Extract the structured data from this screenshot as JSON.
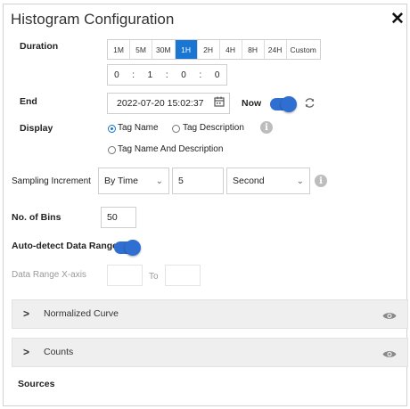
{
  "dialog": {
    "title": "Histogram Configuration",
    "close_label": "✕"
  },
  "duration": {
    "label": "Duration",
    "buttons": [
      "1M",
      "5M",
      "30M",
      "1H",
      "2H",
      "4H",
      "8H",
      "24H",
      "Custom"
    ],
    "active": "1H",
    "time_fields": [
      "0",
      ":",
      "1",
      ":",
      "0",
      ":",
      "0"
    ]
  },
  "end": {
    "label": "End",
    "value": "2022-07-20 15:02:37",
    "now_label": "Now",
    "now_on": true
  },
  "display": {
    "label": "Display",
    "options": [
      "Tag Name",
      "Tag Description",
      "Tag Name And Description"
    ],
    "selected": "Tag Name"
  },
  "sampling": {
    "label": "Sampling Increment",
    "mode": "By Time",
    "value": "5",
    "unit": "Second"
  },
  "bins": {
    "label": "No. of Bins",
    "value": "50"
  },
  "auto_detect": {
    "label": "Auto-detect Data Range",
    "on": true
  },
  "data_range": {
    "label": "Data Range X-axis",
    "from": "",
    "to_label": "To",
    "to": ""
  },
  "sections": [
    {
      "title": "Normalized Curve"
    },
    {
      "title": "Counts"
    }
  ],
  "sources_label": "Sources",
  "colors": {
    "accent": "#1976d2",
    "toggle": "#2f6fd1",
    "section_bg": "#efefef"
  }
}
